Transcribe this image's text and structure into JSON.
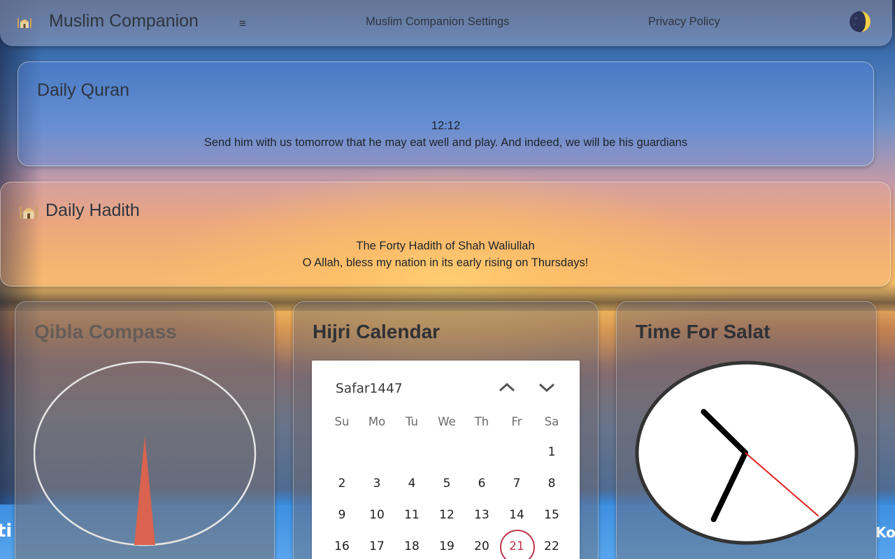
{
  "header": {
    "app_title": "Muslim Companion",
    "menu_glyph": "≡",
    "nav": {
      "settings_label": "Muslim Companion Settings",
      "privacy_label": "Privacy Policy"
    },
    "theme_icon": "moon-phase-icon"
  },
  "quran": {
    "title": "Daily Quran",
    "reference": "12:12",
    "verse": "Send him with us tomorrow that he may eat well and play. And indeed, we will be his guardians"
  },
  "hadith": {
    "title": "Daily Hadith",
    "icon": "mosque-icon",
    "source": "The Forty Hadith of Shah Waliullah",
    "text": "O Allah, bless my nation in its early rising on Thursdays!"
  },
  "qibla": {
    "title": "Qibla Compass",
    "needle_color": "#d9634f"
  },
  "hijri": {
    "title": "Hijri Calendar",
    "month_year": "Safar1447",
    "weekdays": [
      "Su",
      "Mo",
      "Tu",
      "We",
      "Th",
      "Fr",
      "Sa"
    ],
    "weeks": [
      [
        "",
        "",
        "",
        "",
        "",
        "",
        "1"
      ],
      [
        "2",
        "3",
        "4",
        "5",
        "6",
        "7",
        "8"
      ],
      [
        "9",
        "10",
        "11",
        "12",
        "13",
        "14",
        "15"
      ],
      [
        "16",
        "17",
        "18",
        "19",
        "20",
        "21",
        "22"
      ]
    ],
    "selected_day": "21",
    "selected_color": "#c0334b"
  },
  "salat": {
    "title": "Time For Salat",
    "clock_time": {
      "hour": 6,
      "minute": 52,
      "second": 22
    },
    "second_hand_color": "#e02020"
  },
  "colors": {
    "text_dark": "#2e3440",
    "accent_red": "#c0334b"
  }
}
